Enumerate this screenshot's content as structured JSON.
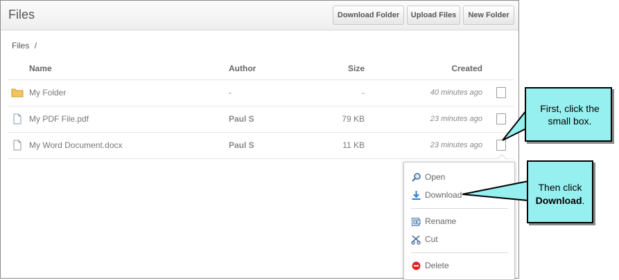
{
  "header": {
    "title": "Files",
    "buttons": {
      "download_folder": "Download Folder",
      "upload_files": "Upload Files",
      "new_folder": "New Folder"
    }
  },
  "breadcrumb": {
    "root": "Files",
    "separator": "/"
  },
  "table": {
    "columns": {
      "name": "Name",
      "author": "Author",
      "size": "Size",
      "created": "Created"
    },
    "rows": [
      {
        "name": "My Folder",
        "author": "-",
        "size": "-",
        "created": "40 minutes ago",
        "icon": "folder-icon"
      },
      {
        "name": "My PDF File.pdf",
        "author": "Paul S",
        "size": "79 KB",
        "created": "23 minutes ago",
        "icon": "file-icon"
      },
      {
        "name": "My Word Document.docx",
        "author": "Paul S",
        "size": "11 KB",
        "created": "23 minutes ago",
        "icon": "file-icon"
      }
    ]
  },
  "context_menu": {
    "open": "Open",
    "download": "Download",
    "rename": "Rename",
    "cut": "Cut",
    "delete": "Delete"
  },
  "callouts": {
    "first": "First, click the small box.",
    "second_prefix": "Then click ",
    "second_bold": "Download",
    "second_suffix": "."
  },
  "colors": {
    "callout_fill": "#97f0f0",
    "folder": "#f2c55c",
    "download_icon": "#2a7fd4",
    "delete_icon": "#d22"
  }
}
